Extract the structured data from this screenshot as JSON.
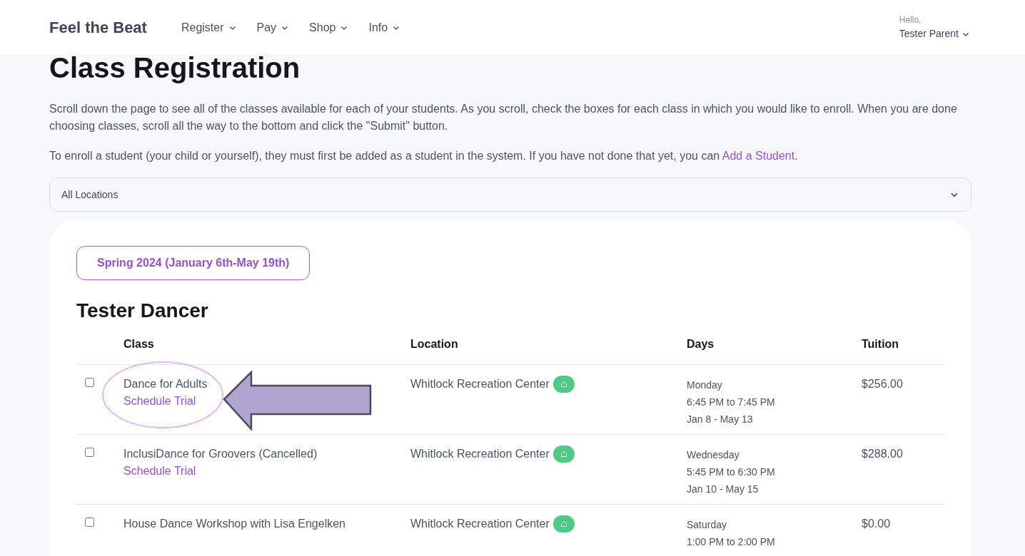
{
  "nav": {
    "brand": "Feel the Beat",
    "menus": [
      {
        "label": "Register"
      },
      {
        "label": "Pay"
      },
      {
        "label": "Shop"
      },
      {
        "label": "Info"
      }
    ],
    "user": {
      "greeting": "Hello,",
      "name": "Tester Parent"
    }
  },
  "page": {
    "title": "Class Registration",
    "intro": [
      "Scroll down the page to see all of the classes available for each of your students. As you scroll, check the boxes for each class in which you would like to enroll. When you are done choosing classes, scroll all the way to the bottom and click the \"Submit\" button.",
      "To enroll a student (your child or yourself), they must first be added as a student in the system. If you have not done that yet, you can "
    ],
    "intro_link": "Add a Student",
    "intro_end": ".",
    "location_select": {
      "value": "All Locations"
    }
  },
  "term_button": "Spring 2024 (January 6th-May 19th)",
  "student": "Tester Dancer",
  "table": {
    "columns": [
      "Class",
      "Location",
      "Days",
      "Tuition"
    ],
    "rows": [
      {
        "checked": false,
        "highlighted": true,
        "class": "Dance for Adults",
        "trial": "Schedule Trial",
        "location": "Whitlock Recreation Center",
        "days": [
          "Monday",
          "6:45 PM to 7:45 PM",
          "Jan 8 - May 13"
        ],
        "tuition": "$256.00"
      },
      {
        "checked": false,
        "highlighted": false,
        "class": "InclusiDance for Groovers (Cancelled)",
        "trial": "Schedule Trial",
        "location": "Whitlock Recreation Center",
        "days": [
          "Wednesday",
          "5:45 PM to 6:30 PM",
          "Jan 10 - May 15"
        ],
        "tuition": "$288.00"
      },
      {
        "checked": false,
        "highlighted": false,
        "class": "House Dance Workshop with Lisa Engelken",
        "location": "Whitlock Recreation Center",
        "days": [
          "Saturday",
          "1:00 PM to 2:00 PM"
        ],
        "tuition": "$0.00"
      }
    ]
  }
}
